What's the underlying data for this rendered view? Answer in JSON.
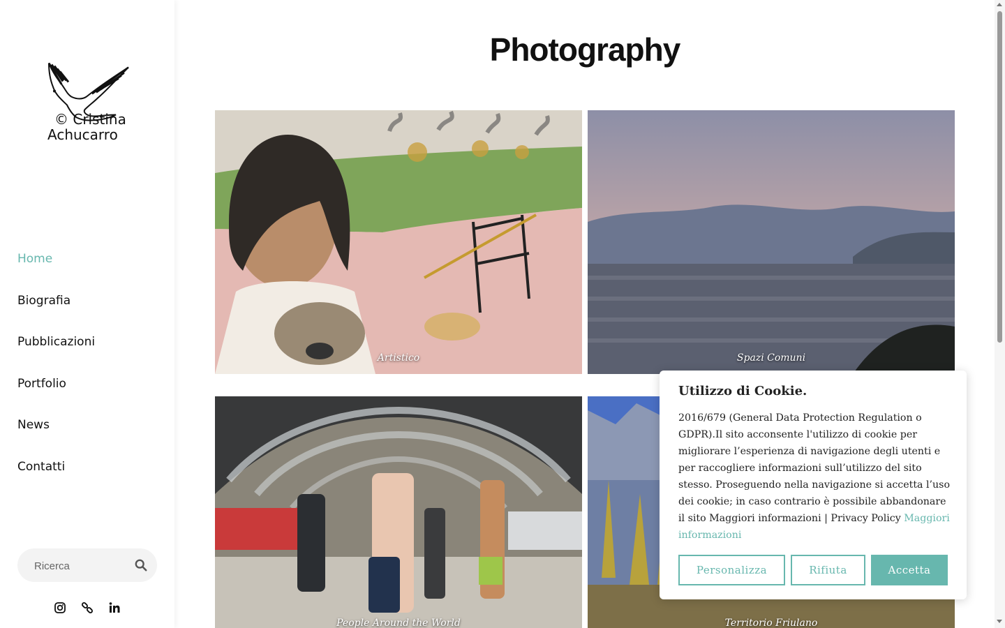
{
  "sidebar": {
    "logo_line1": "© Cristina",
    "logo_line2": "Achucarro",
    "nav": [
      {
        "label": "Home",
        "active": true
      },
      {
        "label": "Biografia"
      },
      {
        "label": "Pubblicazioni"
      },
      {
        "label": "Portfolio"
      },
      {
        "label": "News"
      },
      {
        "label": "Contatti"
      }
    ],
    "search_placeholder": "Ricerca",
    "social": [
      "instagram-icon",
      "link-icon",
      "linkedin-icon"
    ]
  },
  "main": {
    "title": "Photography",
    "tiles": [
      {
        "caption": "Artistico"
      },
      {
        "caption": "Spazi Comuni"
      },
      {
        "caption": "People Around the World"
      },
      {
        "caption": "Territorio Friulano"
      }
    ]
  },
  "cookie": {
    "title": "Utilizzo di Cookie.",
    "text": "2016/679 (General Data Protection Regulation o GDPR).Il sito acconsente l'utilizzo di cookie per migliorare l’esperienza di navigazione degli utenti e per raccogliere informazioni sull’utilizzo del sito stesso. Proseguendo nella navigazione si accetta l’uso dei cookie; in caso contrario è possibile abbandonare il sito Maggiori informazioni | Privacy Policy ",
    "link": "Maggiori informazioni",
    "buttons": {
      "customize": "Personalizza",
      "reject": "Rifiuta",
      "accept": "Accetta"
    }
  },
  "colors": {
    "accent": "#67b7ae"
  }
}
